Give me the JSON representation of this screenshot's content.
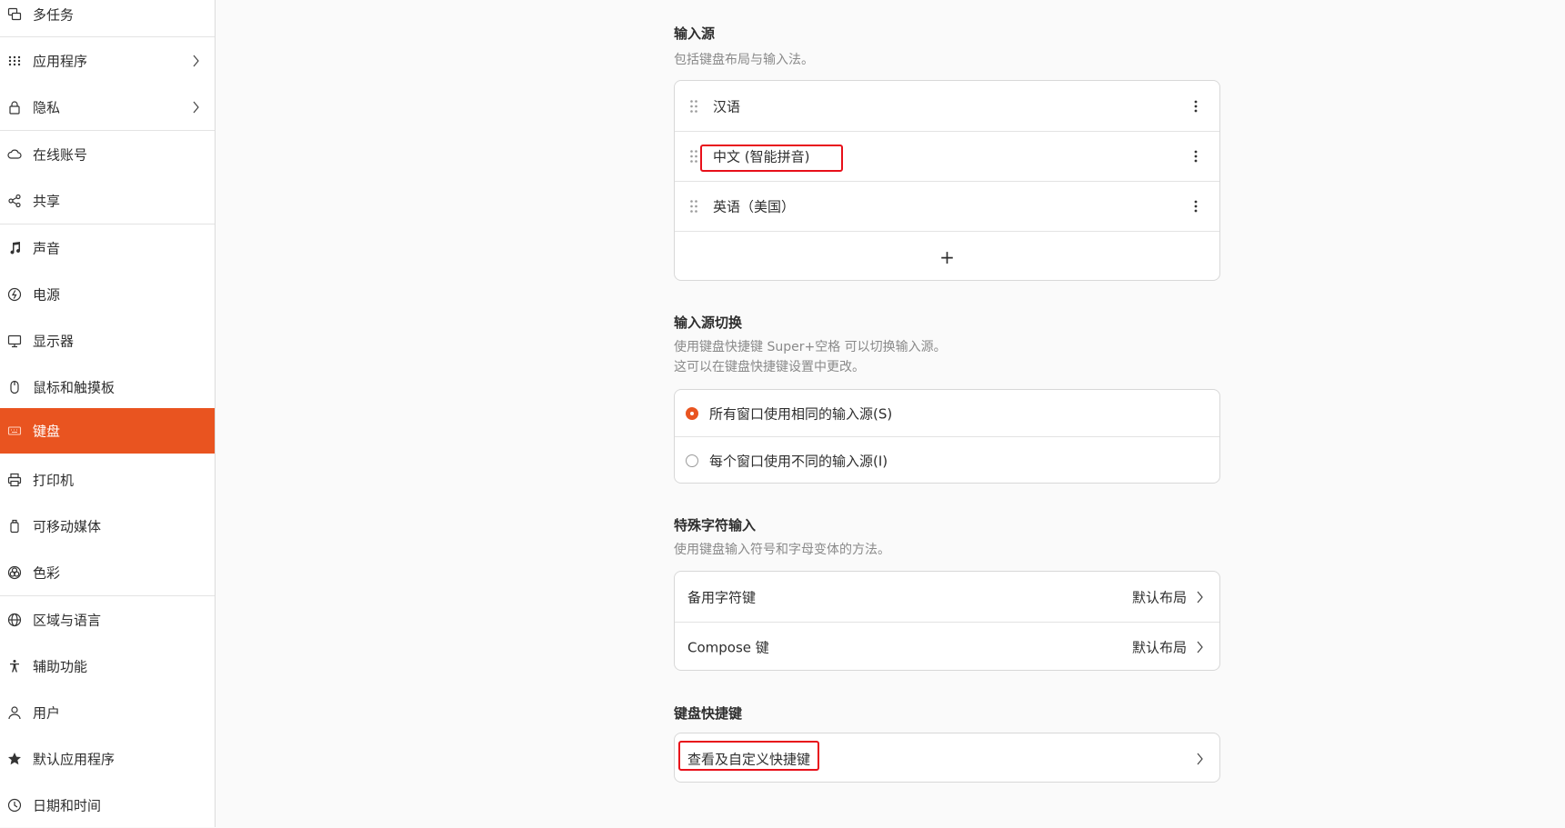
{
  "sidebar": {
    "items": [
      {
        "label": "多任务",
        "icon": "multitasking-icon"
      },
      {
        "label": "应用程序",
        "icon": "apps-grid-icon",
        "chevron": true
      },
      {
        "label": "隐私",
        "icon": "lock-icon",
        "chevron": true
      },
      {
        "label": "在线账号",
        "icon": "cloud-icon"
      },
      {
        "label": "共享",
        "icon": "share-icon"
      },
      {
        "label": "声音",
        "icon": "music-note-icon"
      },
      {
        "label": "电源",
        "icon": "power-icon"
      },
      {
        "label": "显示器",
        "icon": "display-icon"
      },
      {
        "label": "鼠标和触摸板",
        "icon": "mouse-icon"
      },
      {
        "label": "键盘",
        "icon": "keyboard-icon",
        "active": true
      },
      {
        "label": "打印机",
        "icon": "printer-icon"
      },
      {
        "label": "可移动媒体",
        "icon": "removable-media-icon"
      },
      {
        "label": "色彩",
        "icon": "color-icon"
      },
      {
        "label": "区域与语言",
        "icon": "globe-icon"
      },
      {
        "label": "辅助功能",
        "icon": "accessibility-icon"
      },
      {
        "label": "用户",
        "icon": "user-icon"
      },
      {
        "label": "默认应用程序",
        "icon": "star-icon"
      },
      {
        "label": "日期和时间",
        "icon": "clock-icon"
      }
    ]
  },
  "input_sources": {
    "title": "输入源",
    "description": "包括键盘布局与输入法。",
    "items": [
      "汉语",
      "中文 (智能拼音)",
      "英语（美国）"
    ],
    "add_label": "+"
  },
  "switching": {
    "title": "输入源切换",
    "description_line1": "使用键盘快捷键 Super+空格 可以切换输入源。",
    "description_line2": "这可以在键盘快捷键设置中更改。",
    "options": [
      {
        "label": "所有窗口使用相同的输入源(S)",
        "checked": true
      },
      {
        "label": "每个窗口使用不同的输入源(I)",
        "checked": false
      }
    ]
  },
  "special_chars": {
    "title": "特殊字符输入",
    "description": "使用键盘输入符号和字母变体的方法。",
    "rows": [
      {
        "label": "备用字符键",
        "value": "默认布局"
      },
      {
        "label": "Compose 键",
        "value": "默认布局"
      }
    ]
  },
  "shortcuts": {
    "title": "键盘快捷键",
    "row_label": "查看及自定义快捷键"
  },
  "colors": {
    "accent": "#e95420",
    "highlight_box": "#e8101a"
  }
}
